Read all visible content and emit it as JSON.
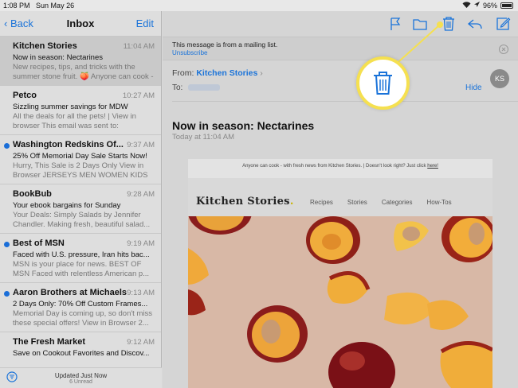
{
  "status_bar": {
    "time": "1:08 PM",
    "date": "Sun May 26",
    "battery": "96%"
  },
  "left_nav": {
    "back_label": "Back",
    "title": "Inbox",
    "edit_label": "Edit"
  },
  "messages": [
    {
      "sender": "Kitchen Stories",
      "time": "11:04 AM",
      "subject": "Now in season: Nectarines",
      "preview": "New recipes, tips, and tricks with the summer stone fruit. 🍑 Anyone can cook -",
      "unread": false,
      "selected": true
    },
    {
      "sender": "Petco",
      "time": "10:27 AM",
      "subject": "Sizzling summer savings for MDW",
      "preview": "All the deals for all the pets! | View in browser This email was sent to:",
      "unread": false,
      "selected": false
    },
    {
      "sender": "Washington Redskins Of...",
      "time": "9:37 AM",
      "subject": "25% Off Memorial Day Sale Starts Now!",
      "preview": "Hurry, This Sale is 2 Days Only View in Browser JERSEYS MEN WOMEN KIDS",
      "unread": true,
      "selected": false
    },
    {
      "sender": "BookBub",
      "time": "9:28 AM",
      "subject": "Your ebook bargains for Sunday",
      "preview": "Your Deals: Simply Salads by Jennifer Chandler. Making fresh, beautiful salad...",
      "unread": false,
      "selected": false
    },
    {
      "sender": "Best of MSN",
      "time": "9:19 AM",
      "subject": "Faced with U.S. pressure, Iran hits bac...",
      "preview": "MSN is your place for news. BEST OF MSN Faced with relentless American p...",
      "unread": true,
      "selected": false
    },
    {
      "sender": "Aaron Brothers at Michaels",
      "time": "9:13 AM",
      "subject": "2 Days Only: 70% Off Custom Frames...",
      "preview": "Memorial Day is coming up, so don't miss these special offers! View in Browser 2...",
      "unread": true,
      "selected": false
    },
    {
      "sender": "The Fresh Market",
      "time": "9:12 AM",
      "subject": "Save on Cookout Favorites and Discov...",
      "preview": "",
      "unread": false,
      "selected": false
    }
  ],
  "left_footer": {
    "updated": "Updated Just Now",
    "unread": "6 Unread"
  },
  "toolbar": {
    "icons": [
      "flag-icon",
      "folder-icon",
      "trash-icon",
      "reply-icon",
      "compose-icon"
    ]
  },
  "banner": {
    "text": "This message is from a mailing list.",
    "unsubscribe": "Unsubscribe"
  },
  "header": {
    "from_label": "From:",
    "from_name": "Kitchen Stories",
    "to_label": "To:",
    "hide_label": "Hide",
    "avatar_initials": "KS"
  },
  "email": {
    "subject": "Now in season: Nectarines",
    "date": "Today at 11:04 AM",
    "top_text": "Anyone can cook - with fresh news from Kitchen Stories. | Doesn't look right? Just click",
    "top_link": "here!",
    "brand": "Kitchen Stories",
    "brand_dot": ".",
    "nav": [
      "Recipes",
      "Stories",
      "Categories",
      "How-Tos"
    ]
  },
  "colors": {
    "accent": "#1a73d9",
    "unread_dot": "#1a6ed8",
    "highlight": "#f5e050"
  }
}
